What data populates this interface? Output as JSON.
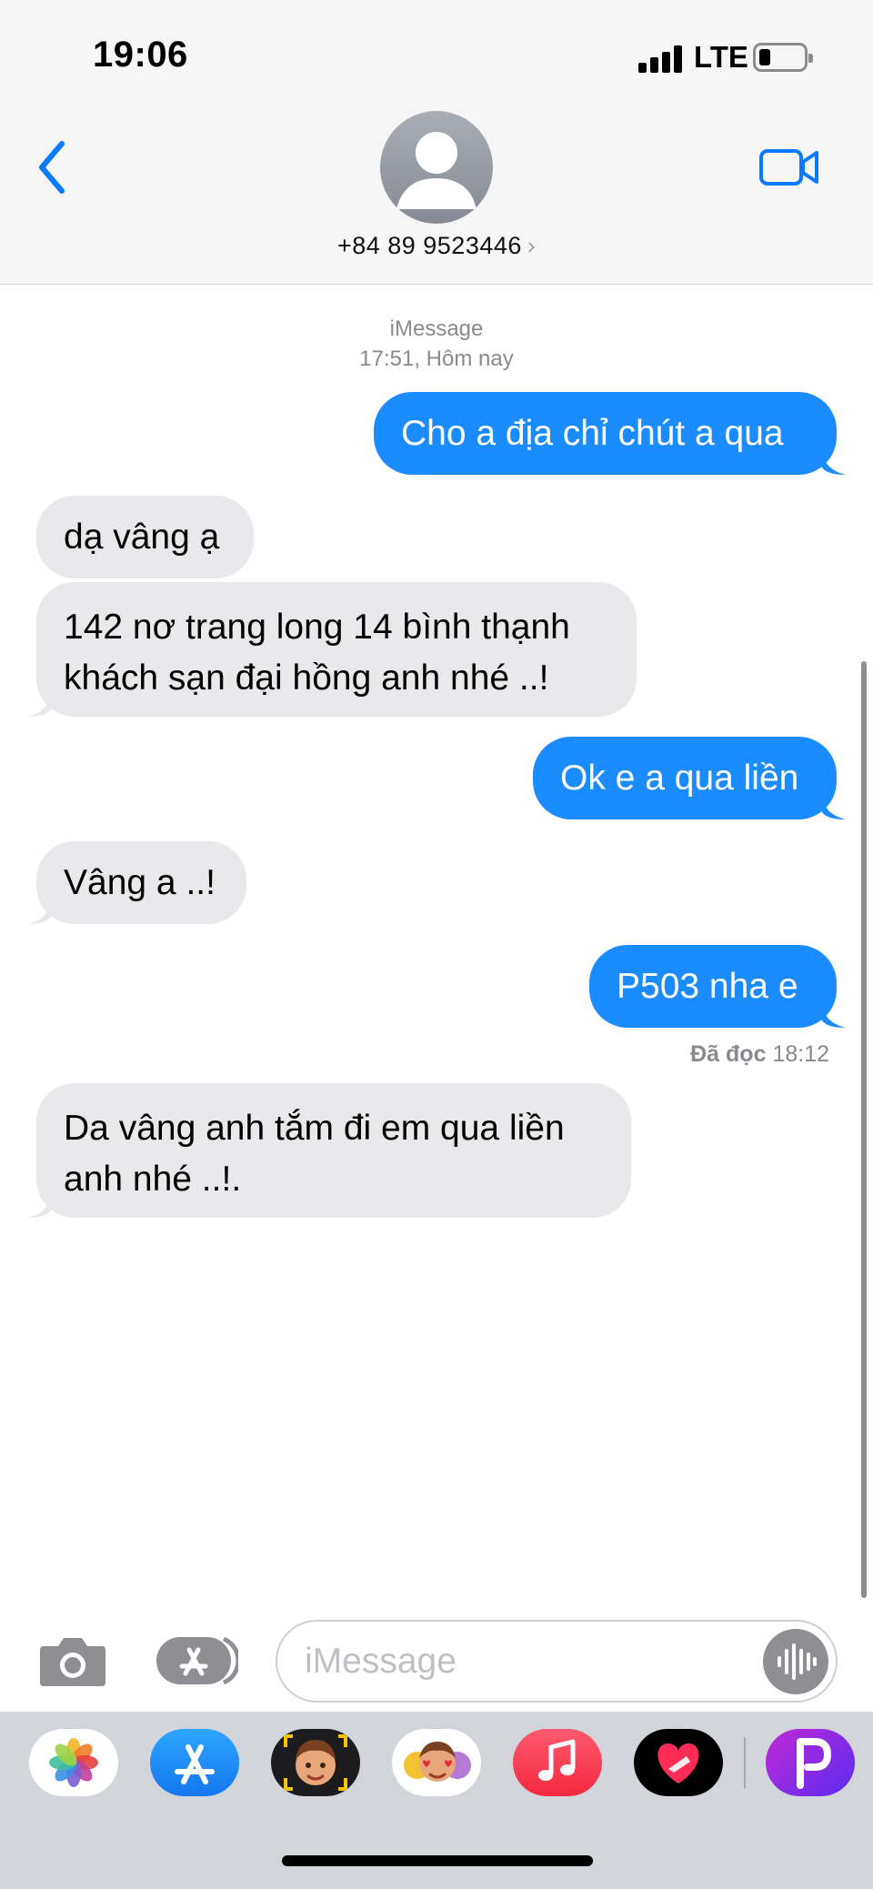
{
  "status_bar": {
    "time": "19:06",
    "carrier": "LTE"
  },
  "header": {
    "contact": "+84 89 9523446",
    "chevron": "›"
  },
  "conversation": {
    "service": "iMessage",
    "timestamp": "17:51, Hôm nay",
    "messages": [
      {
        "from": "me",
        "text": "Cho a địa chỉ chút a qua"
      },
      {
        "from": "them",
        "text": "dạ vâng ạ"
      },
      {
        "from": "them",
        "lines": [
          "142 nơ trang long 14 bình thạnh",
          "khách sạn đại hồng anh nhé ..!"
        ]
      },
      {
        "from": "me",
        "text": "Ok e a qua liền"
      },
      {
        "from": "them",
        "text": "Vâng a ..!"
      },
      {
        "from": "me",
        "text": "P503 nha e"
      },
      {
        "from": "them",
        "lines": [
          "Da vâng anh tắm đi em qua liền",
          "anh nhé ..!."
        ]
      }
    ],
    "read_receipt": {
      "label": "Đã đọc",
      "time": "18:12"
    }
  },
  "input": {
    "placeholder": "iMessage"
  },
  "app_drawer": [
    "photos-icon",
    "app-store-icon",
    "memoji-icon",
    "memoji-stickers-icon",
    "music-icon",
    "digital-touch-icon",
    "picsart-icon"
  ],
  "colors": {
    "bubble_out": "#1a8cff",
    "bubble_in": "#e9e9eb",
    "accent": "#0a7aff"
  }
}
